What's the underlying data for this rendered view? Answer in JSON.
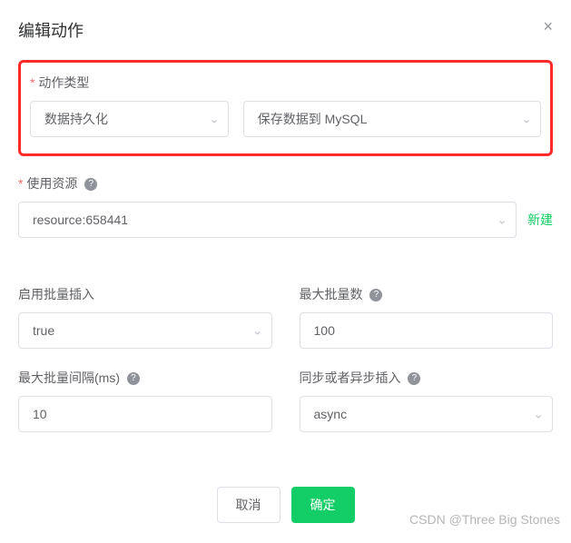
{
  "header": {
    "title": "编辑动作",
    "close_icon": "×"
  },
  "action_type": {
    "label": "动作类型",
    "select1": "数据持久化",
    "select2": "保存数据到 MySQL"
  },
  "resource": {
    "label": "使用资源",
    "value": "resource:658441",
    "new_label": "新建"
  },
  "batch_insert": {
    "label": "启用批量插入",
    "value": "true"
  },
  "max_batch": {
    "label": "最大批量数",
    "value": "100"
  },
  "max_interval": {
    "label": "最大批量间隔(ms)",
    "value": "10"
  },
  "sync_async": {
    "label": "同步或者异步插入",
    "value": "async"
  },
  "footer": {
    "cancel": "取消",
    "confirm": "确定"
  },
  "icons": {
    "help": "?",
    "chevron_down": "⌄"
  },
  "watermark": "CSDN @Three Big Stones"
}
